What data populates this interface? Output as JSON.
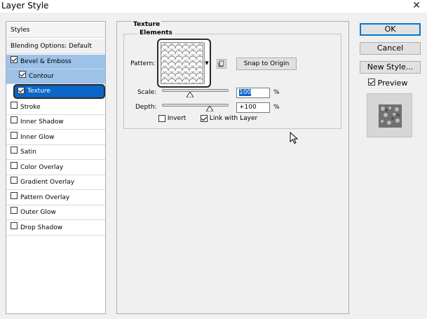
{
  "window": {
    "title": "Layer Style",
    "close_glyph": "✕"
  },
  "styles_panel": {
    "header": "Styles",
    "blending": "Blending Options: Default",
    "items": [
      {
        "label": "Bevel & Emboss",
        "checked": true
      },
      {
        "label": "Contour",
        "checked": true
      },
      {
        "label": "Texture",
        "checked": true
      },
      {
        "label": "Stroke",
        "checked": false
      },
      {
        "label": "Inner Shadow",
        "checked": false
      },
      {
        "label": "Inner Glow",
        "checked": false
      },
      {
        "label": "Satin",
        "checked": false
      },
      {
        "label": "Color Overlay",
        "checked": false
      },
      {
        "label": "Gradient Overlay",
        "checked": false
      },
      {
        "label": "Pattern Overlay",
        "checked": false
      },
      {
        "label": "Outer Glow",
        "checked": false
      },
      {
        "label": "Drop Shadow",
        "checked": false
      }
    ]
  },
  "texture": {
    "section_title": "Texture",
    "group_title": "Elements",
    "pattern_label": "Pattern:",
    "snap_button": "Snap to Origin",
    "scale_label": "Scale:",
    "scale_value": "100",
    "scale_unit": "%",
    "scale_level": 0.42,
    "depth_label": "Depth:",
    "depth_value": "+100",
    "depth_unit": "%",
    "depth_level": 0.72,
    "invert_label": "Invert",
    "invert_checked": false,
    "link_label": "Link with Layer",
    "link_checked": true
  },
  "buttons": {
    "ok": "OK",
    "cancel": "Cancel",
    "new_style": "New Style...",
    "preview_label": "Preview",
    "preview_checked": true
  },
  "icons": {
    "close": "close-icon",
    "dropdown": "chevron-down-icon",
    "new_preset": "new-preset-icon",
    "cursor": "mouse-pointer-icon"
  },
  "colors": {
    "selected": "#0a66c9",
    "active": "#9cc2ea"
  }
}
